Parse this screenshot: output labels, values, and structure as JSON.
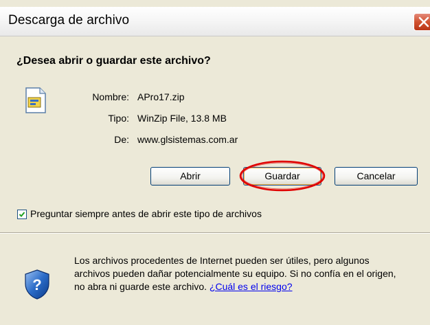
{
  "window": {
    "title": "Descarga de archivo"
  },
  "dialog": {
    "question": "¿Desea abrir o guardar este archivo?",
    "file": {
      "name_label": "Nombre:",
      "name_value": "APro17.zip",
      "type_label": "Tipo:",
      "type_value": "WinZip File, 13.8 MB",
      "from_label": "De:",
      "from_value": "www.glsistemas.com.ar"
    },
    "buttons": {
      "open": "Abrir",
      "save": "Guardar",
      "cancel": "Cancelar"
    },
    "checkbox": {
      "checked": true,
      "label": "Preguntar siempre antes de abrir este tipo de archivos"
    },
    "warning": {
      "text": "Los archivos procedentes de Internet pueden ser útiles, pero algunos archivos pueden dañar potencialmente su equipo. Si no confía en el origen, no abra ni guarde este archivo.",
      "link": "¿Cuál es el riesgo?"
    }
  },
  "colors": {
    "highlight": "#e00000",
    "link": "#0000ee",
    "dialog_bg": "#ece9d8"
  },
  "icons": {
    "close": "close-icon",
    "file": "zip-file-icon",
    "shield": "security-shield-icon",
    "check": "checkmark-icon"
  }
}
